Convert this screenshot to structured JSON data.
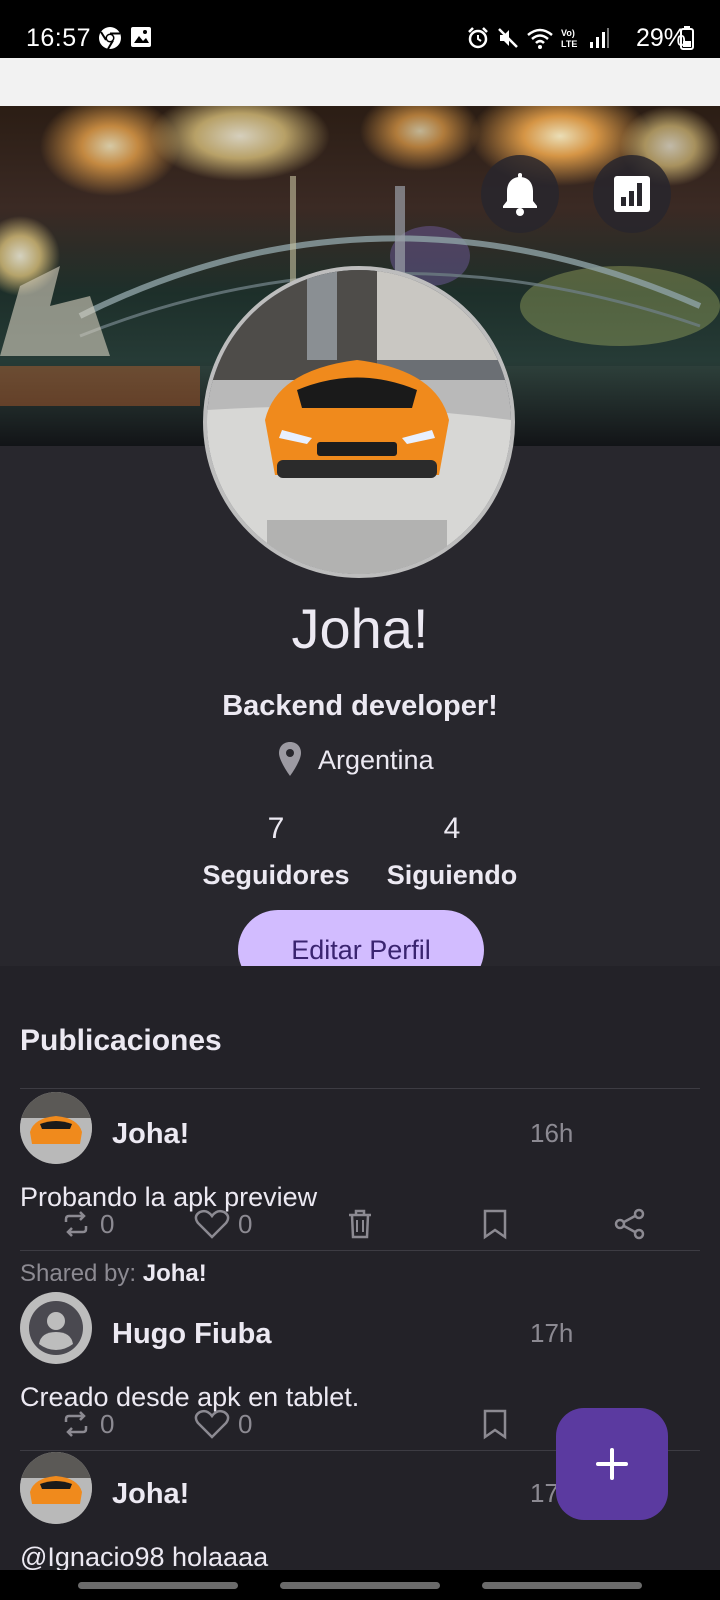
{
  "status_bar": {
    "time": "16:57",
    "battery": "29%",
    "icons": [
      "chrome-icon",
      "gallery-icon",
      "alarm-icon",
      "mute-icon",
      "wifi-icon",
      "volte-icon",
      "signal-icon",
      "battery-icon"
    ]
  },
  "banner": {
    "actions": [
      "bell-icon",
      "stats-icon"
    ]
  },
  "profile": {
    "name": "Joha!",
    "bio": "Backend developer!",
    "location": "Argentina",
    "followers_count": "7",
    "followers_label": "Seguidores",
    "following_count": "4",
    "following_label": "Siguiendo",
    "edit_label": "Editar Perfil"
  },
  "feed": {
    "title": "Publicaciones",
    "posts": [
      {
        "author": "Joha!",
        "time": "16h",
        "text": "Probando la apk preview",
        "retweets": "0",
        "likes": "0",
        "actions": [
          "repost-icon",
          "heart-icon",
          "trash-icon",
          "bookmark-icon",
          "share-icon"
        ]
      },
      {
        "shared_label": "Shared by:",
        "shared_by": "Joha!",
        "author": "Hugo Fiuba",
        "time": "17h",
        "text": "Creado desde apk en tablet.",
        "retweets": "0",
        "likes": "0",
        "actions": [
          "repost-icon",
          "heart-icon",
          "bookmark-icon"
        ]
      },
      {
        "author": "Joha!",
        "time": "17h",
        "text": "@Ignacio98 holaaaa"
      }
    ]
  },
  "fab": {
    "icon": "plus-icon"
  },
  "colors": {
    "background": "#232228",
    "profile_background": "#28272d",
    "edit_button": "#d2bcff",
    "edit_button_text": "#3a2470",
    "fab": "#5b3aa0",
    "muted_text": "#8c8a92"
  }
}
